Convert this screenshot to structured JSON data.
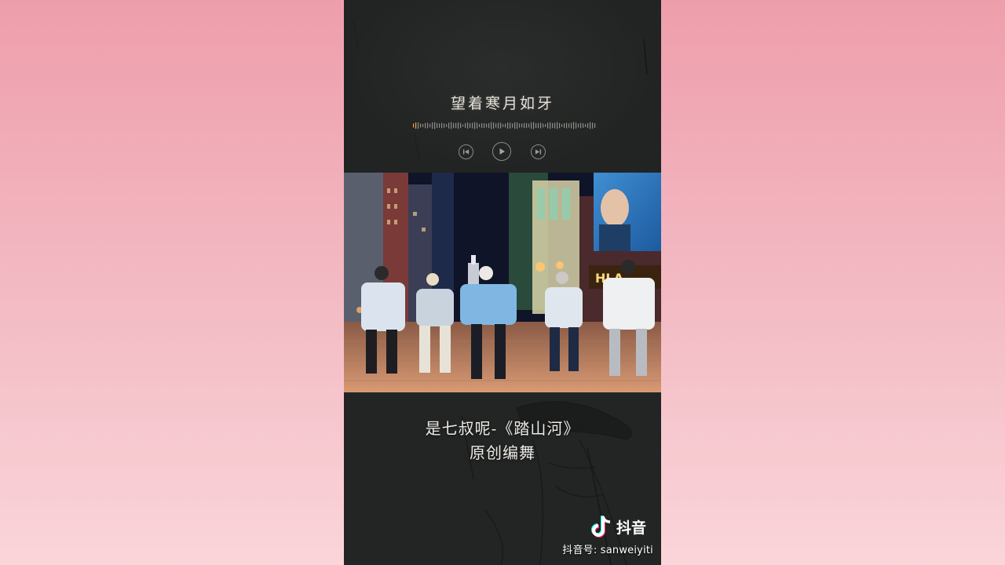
{
  "player": {
    "lyric": "望着寒月如牙",
    "controls": {
      "prev_icon": "skip-previous-icon",
      "play_icon": "play-icon",
      "next_icon": "skip-next-icon"
    }
  },
  "caption": {
    "line1": "是七叔呢-《踏山河》",
    "line2": "原创编舞"
  },
  "watermark": {
    "logo_text": "抖音",
    "account": "抖音号: sanweiyiti"
  },
  "colors": {
    "background_top": "#ee9eab",
    "background_bottom": "#fad5da",
    "panel": "#232524",
    "text": "#e6e2d8"
  }
}
